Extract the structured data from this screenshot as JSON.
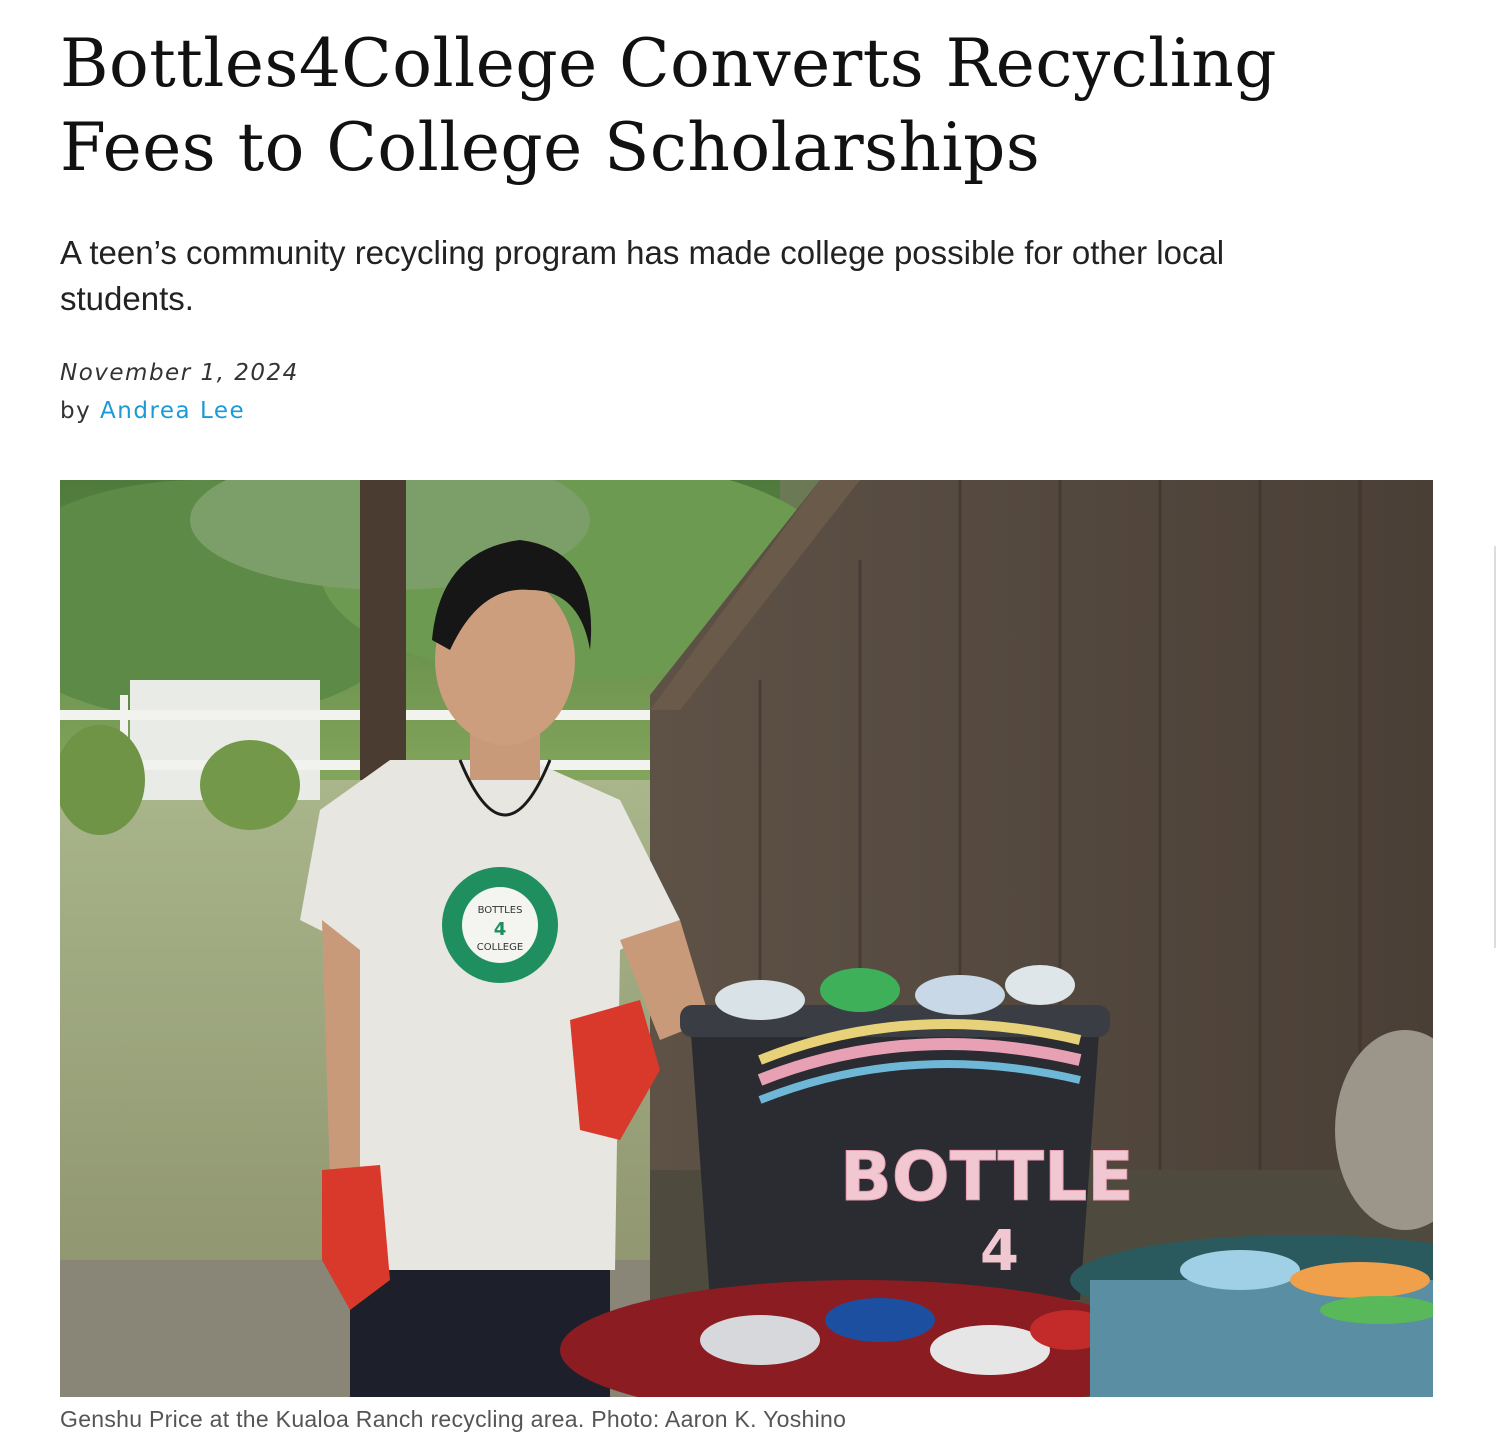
{
  "article": {
    "title": "Bottles4College Converts Recycling Fees to College Scholarships",
    "subtitle": "A teen’s community recycling program has made college possible for other local students.",
    "date": "November 1, 2024",
    "by_prefix": "by ",
    "author": "Andrea Lee"
  },
  "figure": {
    "bin_text": "BOTTLE",
    "bin_number": "4",
    "shirt_text_top": "BOTTLES",
    "shirt_text_number": "4",
    "shirt_text_bottom": "COLLEGE",
    "caption": "Genshu Price at the Kualoa Ranch recycling area. Photo: Aaron K. Yoshino"
  },
  "colors": {
    "link": "#1a9ad6",
    "glove": "#d8392b",
    "shirt_logo": "#1f8f5f"
  }
}
